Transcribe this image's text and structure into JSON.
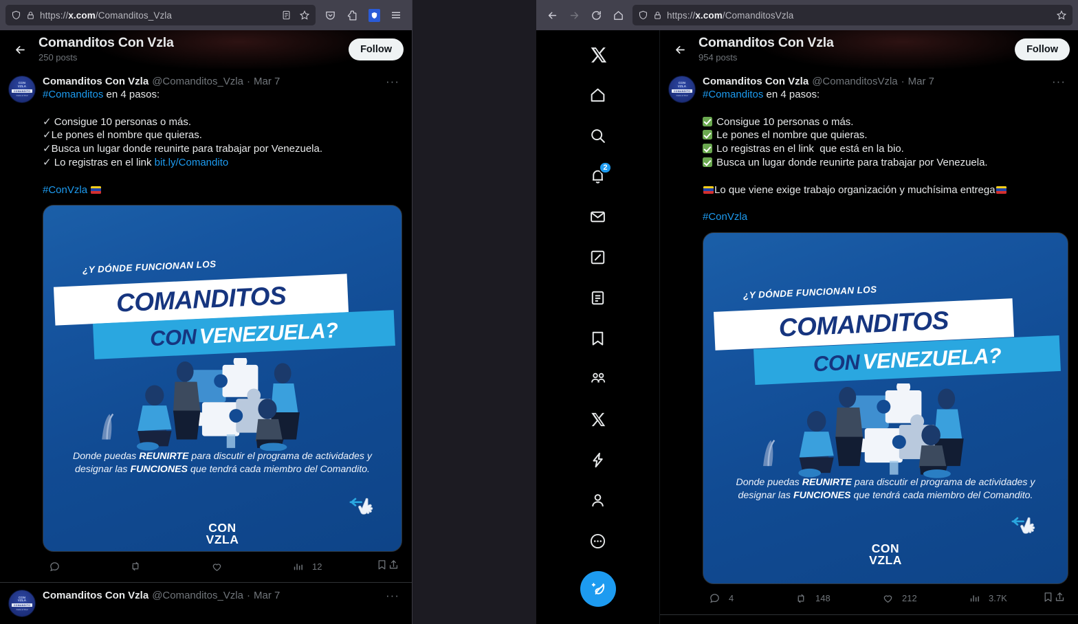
{
  "left_window": {
    "browser": {
      "url_prefix": "https://",
      "url_domain": "x.com",
      "url_path": "/Comanditos_Vzla",
      "shield_icon": "shield-icon",
      "lock_icon": "lock-icon",
      "reader_icon": "reader-view-icon",
      "bookmark_icon": "bookmark-star-icon",
      "pocket_icon": "pocket-save-icon",
      "extensions_icon": "extensions-icon",
      "ublock_icon": "ublock-origin-shield-icon",
      "menu_icon": "hamburger-menu-icon"
    },
    "header": {
      "back_icon": "back-arrow-icon",
      "name": "Comanditos Con Vzla",
      "posts": "250 posts",
      "follow_label": "Follow"
    },
    "tweet": {
      "display_name": "Comanditos Con Vzla",
      "handle": "@Comanditos_Vzla",
      "separator": "·",
      "date": "Mar 7",
      "more_icon": "more-options-icon",
      "hashtag": "#Comanditos",
      "text_after_hashtag": " en 4 pasos:",
      "steps": [
        "Consigue 10 personas o más.",
        "Le pones el nombre que quieras.",
        "Busca un lugar donde reunirte para trabajar por Venezuela.",
        "Lo registras en el link "
      ],
      "step_link": "bit.ly/Comandito",
      "footer_hashtag": "#ConVzla",
      "actions": {
        "reply_icon": "reply-icon",
        "reply_count": "",
        "repost_icon": "repost-icon",
        "repost_count": "",
        "like_icon": "like-heart-icon",
        "like_count": "",
        "views_icon": "views-chart-icon",
        "views_count": "12",
        "bookmark_icon": "bookmark-icon",
        "share_icon": "share-icon"
      }
    },
    "tweet2": {
      "display_name": "Comanditos Con Vzla",
      "handle": "@Comanditos_Vzla",
      "separator": "·",
      "date": "Mar 7",
      "more_icon": "more-options-icon"
    }
  },
  "right_window": {
    "browser": {
      "back_icon": "back-arrow-icon",
      "forward_icon": "forward-arrow-icon",
      "reload_icon": "reload-icon",
      "home_icon": "home-icon",
      "url_prefix": "https://",
      "url_domain": "x.com",
      "url_path": "/ComanditosVzla",
      "shield_icon": "shield-icon",
      "lock_icon": "lock-icon",
      "bookmark_icon": "bookmark-star-icon"
    },
    "nav": {
      "items": [
        {
          "icon": "x-logo-icon",
          "name": "x-logo",
          "badge": ""
        },
        {
          "icon": "home-icon",
          "name": "home",
          "badge": ""
        },
        {
          "icon": "search-icon",
          "name": "explore",
          "badge": ""
        },
        {
          "icon": "bell-icon",
          "name": "notifications",
          "badge": "2"
        },
        {
          "icon": "envelope-icon",
          "name": "messages",
          "badge": ""
        },
        {
          "icon": "grok-icon",
          "name": "grok",
          "badge": ""
        },
        {
          "icon": "list-icon",
          "name": "lists",
          "badge": ""
        },
        {
          "icon": "bookmark-icon",
          "name": "bookmarks",
          "badge": ""
        },
        {
          "icon": "communities-icon",
          "name": "communities",
          "badge": ""
        },
        {
          "icon": "x-premium-icon",
          "name": "premium",
          "badge": ""
        },
        {
          "icon": "lightning-icon",
          "name": "verified-orgs",
          "badge": ""
        },
        {
          "icon": "person-icon",
          "name": "profile",
          "badge": ""
        },
        {
          "icon": "more-circle-icon",
          "name": "more",
          "badge": ""
        }
      ],
      "compose_icon": "compose-post-icon"
    },
    "header": {
      "back_icon": "back-arrow-icon",
      "name": "Comanditos Con Vzla",
      "posts": "954 posts",
      "follow_label": "Follow"
    },
    "tweet": {
      "display_name": "Comanditos Con Vzla",
      "handle": "@ComanditosVzla",
      "separator": "·",
      "date": "Mar 7",
      "more_icon": "more-options-icon",
      "hashtag": "#Comanditos",
      "text_after_hashtag": " en 4 pasos:",
      "steps": [
        "Consigue 10 personas o más.",
        "Le pones el nombre que quieras.",
        "Lo registras en el link  que está en la bio.",
        "Busca un lugar donde reunirte para trabajar por Venezuela."
      ],
      "closing_line": "Lo que viene exige trabajo organización y muchísima entrega",
      "footer_hashtag": "#ConVzla",
      "actions": {
        "reply_icon": "reply-icon",
        "reply_count": "4",
        "repost_icon": "repost-icon",
        "repost_count": "148",
        "like_icon": "like-heart-icon",
        "like_count": "212",
        "views_icon": "views-chart-icon",
        "views_count": "3.7K",
        "bookmark_icon": "bookmark-icon",
        "share_icon": "share-icon"
      }
    }
  },
  "poster": {
    "kicker": "¿Y DÓNDE FUNCIONAN LOS",
    "line1": "COMANDITOS",
    "line2_blue": "CON",
    "line2_white": "VENEZUELA?",
    "blurb_1": "Donde puedas ",
    "blurb_bold1": "REUNIRTE",
    "blurb_2": " para discutir el programa de actividades y designar las ",
    "blurb_bold2": "FUNCIONES",
    "blurb_3": " que tendrá cada miembro del Comandito.",
    "logo_line1": "CON",
    "logo_line2": "VZLA",
    "cursor_icon": "hand-pointer-icon",
    "illustration": "people-assembling-puzzle-illustration"
  },
  "colors": {
    "twitter_blue": "#1d9bf0",
    "poster_blue": "#134b93",
    "poster_cyan": "#2aa7e0",
    "poster_navy": "#16357f",
    "text_primary": "#e7e9ea",
    "text_secondary": "#71767b",
    "check_green": "#6aa84f",
    "chrome_bg": "#42414d",
    "urlbar_bg": "#2b2a33"
  }
}
